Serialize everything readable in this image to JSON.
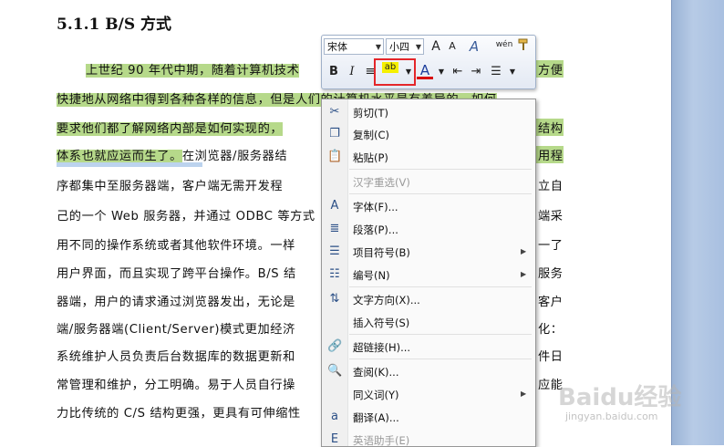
{
  "document": {
    "heading": "5.1.1 B/S 方式",
    "lines": [
      {
        "hl": "上世纪 90 年代中期，随着计算机技术",
        "rest": "",
        "tail": "方便"
      },
      {
        "hl": "快捷地从网络中得到各种各样的信息，但是人们的计算机水平是有差异的，如何",
        "rest": "",
        "tail": ""
      },
      {
        "hl": "要求他们都了解网络内部是如何实现的，",
        "rest": "",
        "tail": "结构"
      },
      {
        "hl": "体系也就应运而生了。",
        "rest": "在浏览器/服务器结",
        "tail": "用程"
      },
      {
        "hl": "",
        "rest": "序都集中至服务器端，客户端无需开发程",
        "tail": "立自"
      },
      {
        "hl": "",
        "rest": "己的一个 Web 服务器，并通过 ODBC 等方式",
        "tail": "端采"
      },
      {
        "hl": "",
        "rest": "用不同的操作系统或者其他软件环境。一样",
        "tail": "一了"
      },
      {
        "hl": "",
        "rest": "用户界面，而且实现了跨平台操作。B/S 结",
        "tail": "服务"
      },
      {
        "hl": "",
        "rest": "器端，用户的请求通过浏览器发出，无论是",
        "tail": "客户"
      },
      {
        "hl": "",
        "rest": "端/服务器端(Client/Server)模式更加经济",
        "tail": "化："
      },
      {
        "hl": "",
        "rest": "系统维护人员负责后台数据库的数据更新和",
        "tail": "件日"
      },
      {
        "hl": "",
        "rest": "常管理和维护，分工明确。易于人员自行操",
        "tail": "应能"
      },
      {
        "hl": "",
        "rest": "力比传统的 C/S 结构更强，更具有可伸缩性",
        "tail": ""
      }
    ]
  },
  "mini_toolbar": {
    "font_name": "宋体",
    "font_size": "小四",
    "grow_font": "A",
    "shrink_font": "A",
    "styles": "A",
    "phonetic": "wén",
    "format_painter": "brush-icon",
    "bold": "B",
    "italic": "I",
    "center": "≡",
    "highlight": "ab",
    "font_color": "A"
  },
  "context_menu": {
    "items": [
      {
        "icon": "scissors-icon",
        "glyph": "✂",
        "label": "剪切(T)",
        "disabled": false,
        "submenu": false
      },
      {
        "icon": "copy-icon",
        "glyph": "❐",
        "label": "复制(C)",
        "disabled": false,
        "submenu": false
      },
      {
        "icon": "paste-icon",
        "glyph": "📋",
        "label": "粘贴(P)",
        "disabled": false,
        "submenu": false
      },
      {
        "icon": "",
        "glyph": "",
        "label": "汉字重选(V)",
        "disabled": true,
        "submenu": false
      },
      {
        "icon": "font-icon",
        "glyph": "A",
        "label": "字体(F)...",
        "disabled": false,
        "submenu": false
      },
      {
        "icon": "paragraph-icon",
        "glyph": "≣",
        "label": "段落(P)...",
        "disabled": false,
        "submenu": false
      },
      {
        "icon": "bullets-icon",
        "glyph": "☰",
        "label": "项目符号(B)",
        "disabled": false,
        "submenu": true
      },
      {
        "icon": "numbering-icon",
        "glyph": "☷",
        "label": "编号(N)",
        "disabled": false,
        "submenu": true
      },
      {
        "icon": "text-direction-icon",
        "glyph": "⇅",
        "label": "文字方向(X)...",
        "disabled": false,
        "submenu": false
      },
      {
        "icon": "",
        "glyph": "",
        "label": "插入符号(S)",
        "disabled": false,
        "submenu": false
      },
      {
        "icon": "hyperlink-icon",
        "glyph": "🔗",
        "label": "超链接(H)...",
        "disabled": false,
        "submenu": false
      },
      {
        "icon": "lookup-icon",
        "glyph": "🔍",
        "label": "查阅(K)...",
        "disabled": false,
        "submenu": false
      },
      {
        "icon": "",
        "glyph": "",
        "label": "同义词(Y)",
        "disabled": false,
        "submenu": true
      },
      {
        "icon": "translate-icon",
        "glyph": "a",
        "label": "翻译(A)...",
        "disabled": false,
        "submenu": false
      },
      {
        "icon": "english-assistant-icon",
        "glyph": "E",
        "label": "英语助手(E)",
        "disabled": true,
        "submenu": false
      }
    ],
    "submenu_arrow": "▶"
  },
  "watermark": {
    "brand": "Baidu经验",
    "url": "jingyan.baidu.com"
  }
}
